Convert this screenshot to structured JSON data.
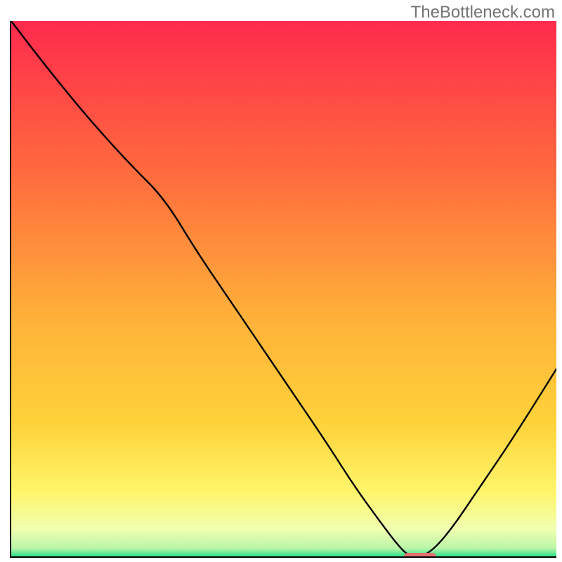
{
  "watermark": "TheBottleneck.com",
  "colors": {
    "axis": "#000000",
    "curve": "#000000",
    "marker": "#e37070",
    "gradient_top": "#ff2a4d",
    "gradient_mid_upper": "#ff8a3a",
    "gradient_mid": "#ffd23a",
    "gradient_mid_lower": "#fff56b",
    "gradient_lower": "#f4ffb0",
    "gradient_bottom": "#2fe08a"
  },
  "chart_data": {
    "type": "line",
    "title": "",
    "xlabel": "",
    "ylabel": "",
    "xlim": [
      0,
      100
    ],
    "ylim": [
      0,
      100
    ],
    "grid": false,
    "series": [
      {
        "name": "bottleneck-curve",
        "x": [
          0,
          6,
          14,
          22,
          28,
          34,
          40,
          46,
          52,
          58,
          63,
          68,
          71,
          73,
          76,
          80,
          86,
          92,
          100
        ],
        "y": [
          100,
          92,
          82,
          73,
          67,
          57,
          48,
          39,
          30,
          21,
          13,
          6,
          2,
          0,
          0,
          4,
          13,
          22,
          35
        ]
      }
    ],
    "optimum_band_x": [
      72,
      78
    ],
    "annotations": []
  }
}
